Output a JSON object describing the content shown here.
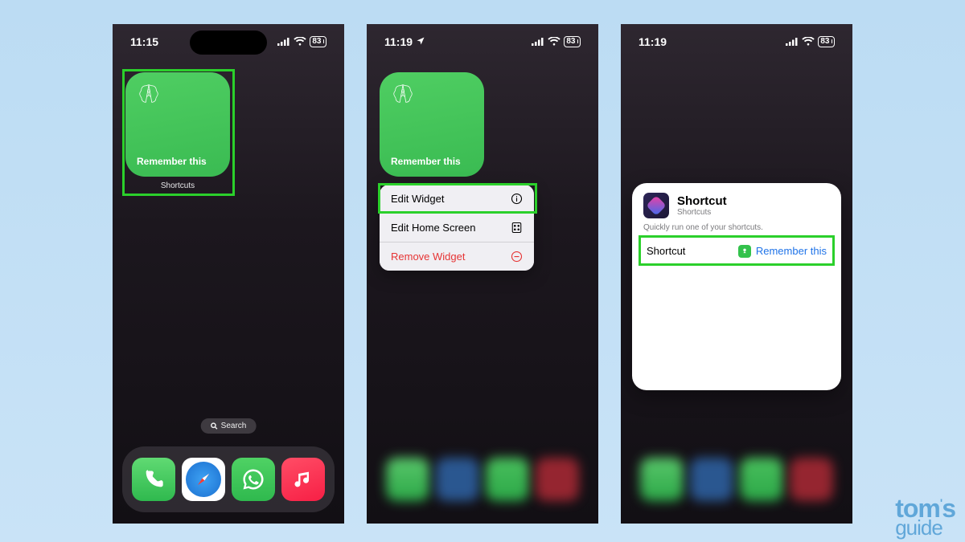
{
  "status": {
    "time1": "11:15",
    "time2": "11:19",
    "time3": "11:19",
    "battery": "83"
  },
  "widget": {
    "label": "Remember this",
    "caption": "Shortcuts"
  },
  "search": {
    "label": "Search"
  },
  "menu": {
    "edit_widget": "Edit Widget",
    "edit_home": "Edit Home Screen",
    "remove": "Remove Widget"
  },
  "config": {
    "title": "Shortcut",
    "subtitle": "Shortcuts",
    "description": "Quickly run one of your shortcuts.",
    "row_label": "Shortcut",
    "row_value": "Remember this"
  },
  "dock": {
    "apps": [
      "Phone",
      "Safari",
      "WhatsApp",
      "Music"
    ]
  },
  "brand": {
    "line1": "tom",
    "apostrophe": "'",
    "s": "s",
    "line2": "guide"
  }
}
